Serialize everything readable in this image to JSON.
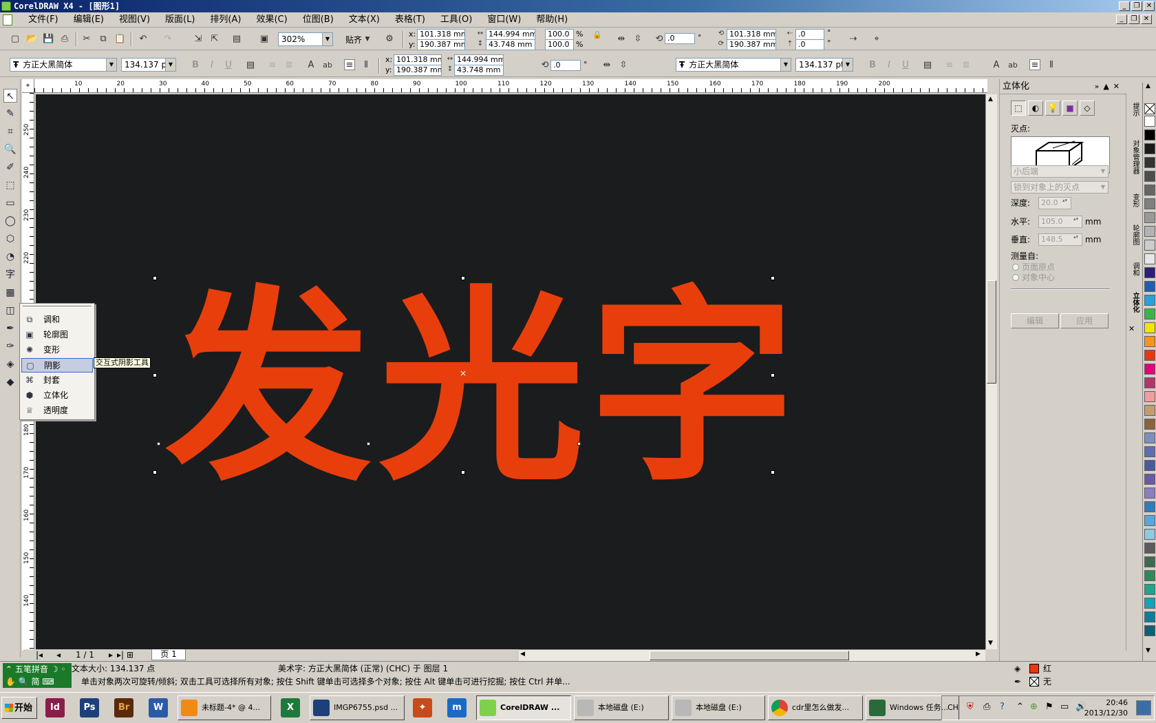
{
  "window": {
    "title": "CorelDRAW X4 - [图形1]"
  },
  "menu": [
    "文件(F)",
    "编辑(E)",
    "视图(V)",
    "版面(L)",
    "排列(A)",
    "效果(C)",
    "位图(B)",
    "文本(X)",
    "表格(T)",
    "工具(O)",
    "窗口(W)",
    "帮助(H)"
  ],
  "toolbar1": {
    "zoom": "302%",
    "snap_label": "贴齐",
    "x": "101.318 mm",
    "y": "190.387 mm",
    "width": "144.994 mm",
    "height": "43.748 mm",
    "scale_x": "100.0",
    "scale_y": "100.0",
    "percent": "%",
    "rotation": ".0",
    "pos_x2": "101.318 mm",
    "pos_y2": "190.387 mm",
    "skew_h": ".0",
    "skew_v": ".0",
    "degree": "°"
  },
  "toolbar2": {
    "font_name": "方正大黑简体",
    "font_size": "134.137 pt",
    "x": "101.318 mm",
    "y": "190.387 mm",
    "width": "144.994 mm",
    "height": "43.748 mm",
    "rotation": ".0",
    "font_name2": "方正大黑简体",
    "font_size2": "134.137 pt",
    "x_label": "x:",
    "y_label": "y:"
  },
  "ruler": {
    "top": [
      "10",
      "20",
      "30",
      "40",
      "50",
      "60",
      "70",
      "80",
      "90",
      "100",
      "110",
      "120",
      "130",
      "140",
      "150",
      "160",
      "170",
      "180",
      "190",
      "200"
    ],
    "left": [
      "250",
      "240",
      "230",
      "220",
      "180",
      "170",
      "160",
      "150",
      "140"
    ]
  },
  "artwork": {
    "chars": [
      "发",
      "光",
      "字"
    ],
    "fill_color": "#e83e0c",
    "background": "#1b1c1e"
  },
  "flyout": {
    "items": [
      "调和",
      "轮廓图",
      "变形",
      "阴影",
      "封套",
      "立体化",
      "透明度"
    ],
    "active": "阴影",
    "tooltip": "交互式阴影工具"
  },
  "pagebar": {
    "counter": "1 / 1",
    "tab": "页 1"
  },
  "docker": {
    "title": "立体化",
    "vanishing_label": "灭点:",
    "dd1": "小后端",
    "dd2": "锁到对象上的灭点",
    "depth_label": "深度:",
    "depth": "20.0",
    "horiz_label": "水平:",
    "horiz": "105.0",
    "vert_label": "垂直:",
    "vert": "148.5",
    "unit": "mm",
    "measure_label": "测量自:",
    "radio1": "页面原点",
    "radio2": "对象中心",
    "edit_btn": "编辑",
    "apply_btn": "应用"
  },
  "sidetabs": [
    "提示",
    "对象管理器",
    "变形",
    "轮廓图",
    "调和",
    "立体化"
  ],
  "palette": [
    "#ffffff",
    "#000000",
    "#1a1a1a",
    "#333333",
    "#4d4d4d",
    "#666666",
    "#808080",
    "#999999",
    "#b3b3b3",
    "#cccccc",
    "#e6e6e6",
    "#2b1f7a",
    "#1e5fb4",
    "#2aa0d8",
    "#3ab54a",
    "#f2e500",
    "#f7941d",
    "#e8380d",
    "#e4007f",
    "#b5366b",
    "#f29c9f",
    "#c69c6d",
    "#8c6239",
    "#7e8ec2",
    "#5d6db0",
    "#4a5a9f",
    "#6a5aa6",
    "#8b7fc0",
    "#2f7dc0",
    "#58a7dc",
    "#8ecae6",
    "#5b5b5b",
    "#3d6b4f",
    "#2e8b57",
    "#1fa58a",
    "#17a2b8",
    "#0f7c9c",
    "#0d5f7a"
  ],
  "status": {
    "ime1": "五笔拼音",
    "ime2": "简",
    "line1a": "文本大小: 134.137 点",
    "line1b": "美术字: 方正大黑简体 (正常) (CHC) 于 图层 1",
    "line2": "单击对象两次可旋转/倾斜; 双击工具可选择所有对象; 按住 Shift 键单击可选择多个对象; 按住 Alt 键单击可进行挖掘; 按住 Ctrl 并单...",
    "fill_label": "红",
    "outline_label": "无"
  },
  "taskbar": {
    "start": "开始",
    "tasks": [
      "未标题-4* @ 4...",
      "IMGP6755.psd ...",
      "CorelDRAW ...",
      "本地磁盘 (E:)",
      "本地磁盘 (E:)",
      "cdr里怎么做发...",
      "Windows 任务..."
    ],
    "lang": "CH",
    "time": "20:46",
    "date": "2013/12/30"
  }
}
